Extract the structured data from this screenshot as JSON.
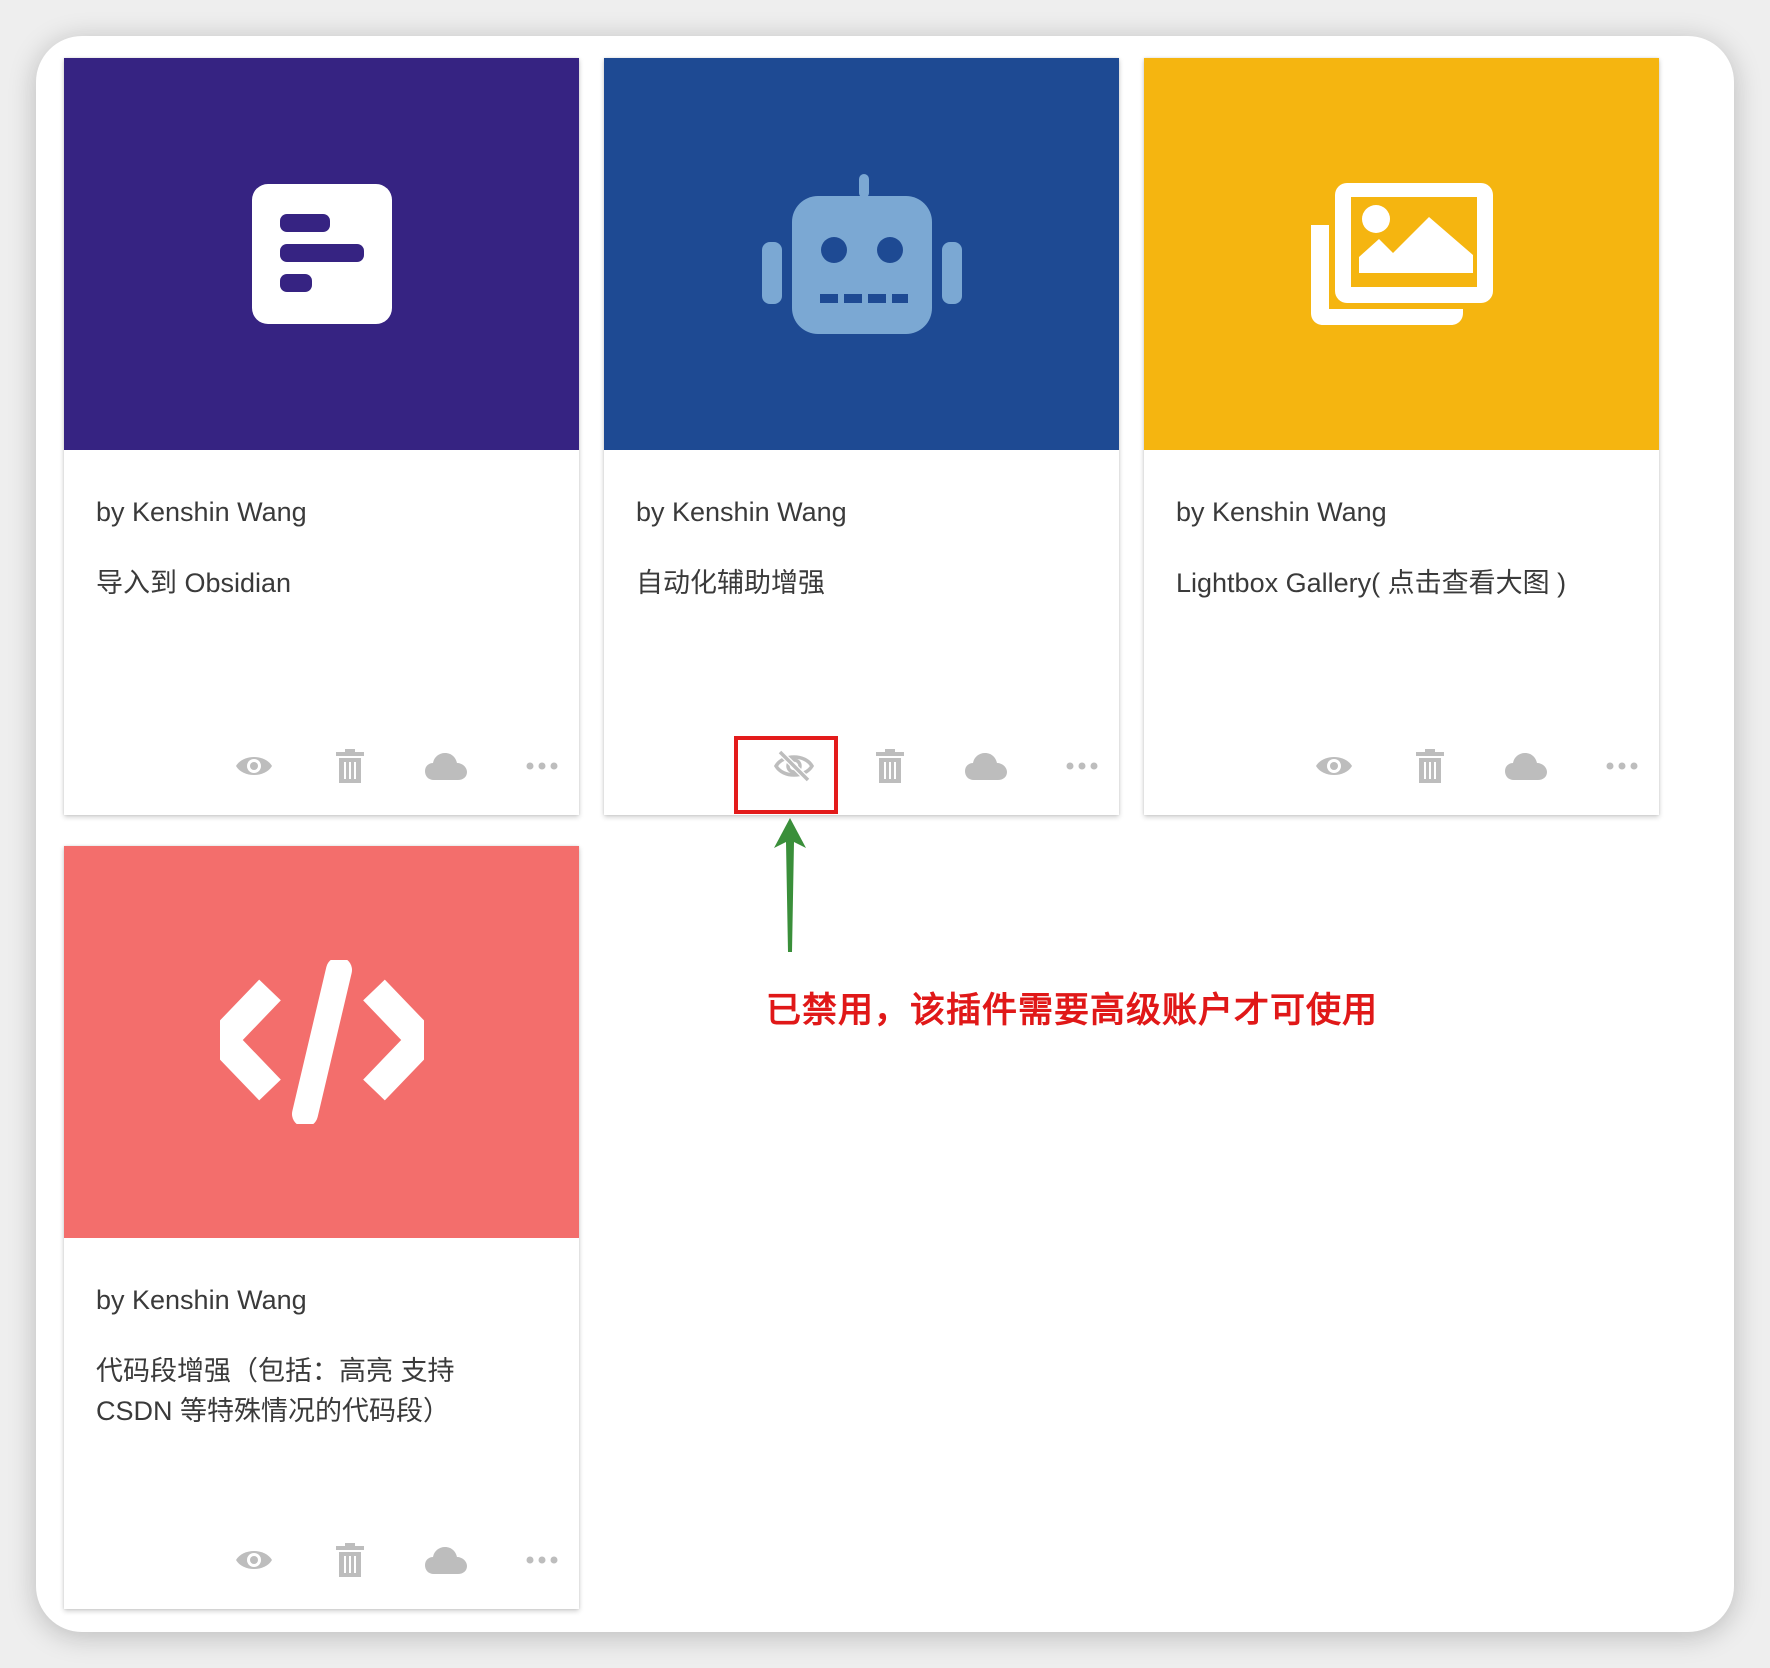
{
  "cards": [
    {
      "author": "by Kenshin Wang",
      "description": "导入到 Obsidian",
      "color": "#362382",
      "icon": "obsidian-document-icon",
      "actions": [
        "eye-icon",
        "trash-icon",
        "cloud-icon",
        "more-icon"
      ]
    },
    {
      "author": "by Kenshin Wang",
      "description": "自动化辅助增强",
      "color": "#1e4a93",
      "icon": "robot-icon",
      "actions": [
        "eye-slash-icon",
        "trash-icon",
        "cloud-icon",
        "more-icon"
      ]
    },
    {
      "author": "by Kenshin Wang",
      "description": "Lightbox Gallery( 点击查看大图 )",
      "color": "#f5b510",
      "icon": "images-icon",
      "actions": [
        "eye-icon",
        "trash-icon",
        "cloud-icon",
        "more-icon"
      ]
    },
    {
      "author": "by Kenshin Wang",
      "description": "代码段增强（包括：高亮 支持 CSDN 等特殊情况的代码段）",
      "color": "#f36e6c",
      "icon": "code-icon",
      "actions": [
        "eye-icon",
        "trash-icon",
        "cloud-icon",
        "more-icon"
      ]
    }
  ],
  "annotation": {
    "text": "已禁用，该插件需要高级账户才可使用",
    "text_color": "#e01818",
    "box_color": "#e31b1b",
    "arrow_color": "#3a8f3a"
  },
  "action_icon_color": "#bdbdbd"
}
